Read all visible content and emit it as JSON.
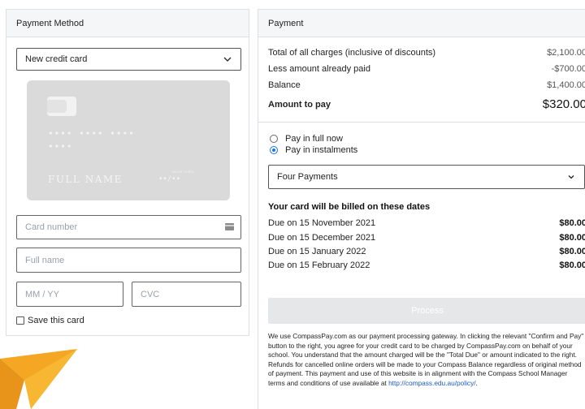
{
  "payment_method": {
    "header": "Payment Method",
    "method_select": {
      "selected": "New credit card"
    },
    "card_preview": {
      "dots_line1": "•••• •••• ••••",
      "dots_line2": "••••",
      "name": "FULL NAME",
      "valid_thru": "VALID THRU",
      "expiry": "••/••"
    },
    "card_number": {
      "placeholder": "Card number",
      "icon": "credit-card-icon"
    },
    "full_name": {
      "placeholder": "Full name"
    },
    "expiry": {
      "placeholder": "MM / YY"
    },
    "cvc": {
      "placeholder": "CVC"
    },
    "save_card": {
      "label": "Save this card",
      "checked": false
    }
  },
  "payment": {
    "header": "Payment",
    "summary": [
      {
        "label": "Total of all charges (inclusive of discounts)",
        "value": "$2,100.00"
      },
      {
        "label": "Less amount already paid",
        "value": "-$700.00"
      },
      {
        "label": "Balance",
        "value": "$1,400.00"
      },
      {
        "label": "Amount to pay",
        "value": "$320.00"
      }
    ],
    "options": [
      {
        "label": "Pay in full now",
        "checked": false
      },
      {
        "label": "Pay in instalments",
        "checked": true
      }
    ],
    "plan_select": {
      "selected": "Four Payments"
    },
    "billed_heading": "Your card will be billed on these dates",
    "schedule": [
      {
        "label": "Due on 15 November 2021",
        "amount": "$80.00"
      },
      {
        "label": "Due on 15 December 2021",
        "amount": "$80.00"
      },
      {
        "label": "Due on 15 January 2022",
        "amount": "$80.00"
      },
      {
        "label": "Due on 15 February 2022",
        "amount": "$80.00"
      }
    ],
    "process_button": "Process",
    "disclaimer": "We use CompassPay.com as our payment processing gateway. In clicking the relevant \"Confirm and Pay\" button to the right, you agree for your credit card to be charged by CompassPay.com on behalf of your school. You understand that the amount charged will be the \"Total Due\" or amount indicated to the right. Refunds for cancelled online orders will be made to your Compass Balance regardless of original method of payment. This payment and use of this website is in alignment with the Compass School Manager terms and conditions of use available at ",
    "policy_link": "http://compass.edu.au/policy/",
    "disclaimer_end": "."
  },
  "colors": {
    "accent": "#1a73e8",
    "card_preview": "#dadada",
    "button_disabled": "#e6e7e8",
    "plane": "#f5a623"
  }
}
